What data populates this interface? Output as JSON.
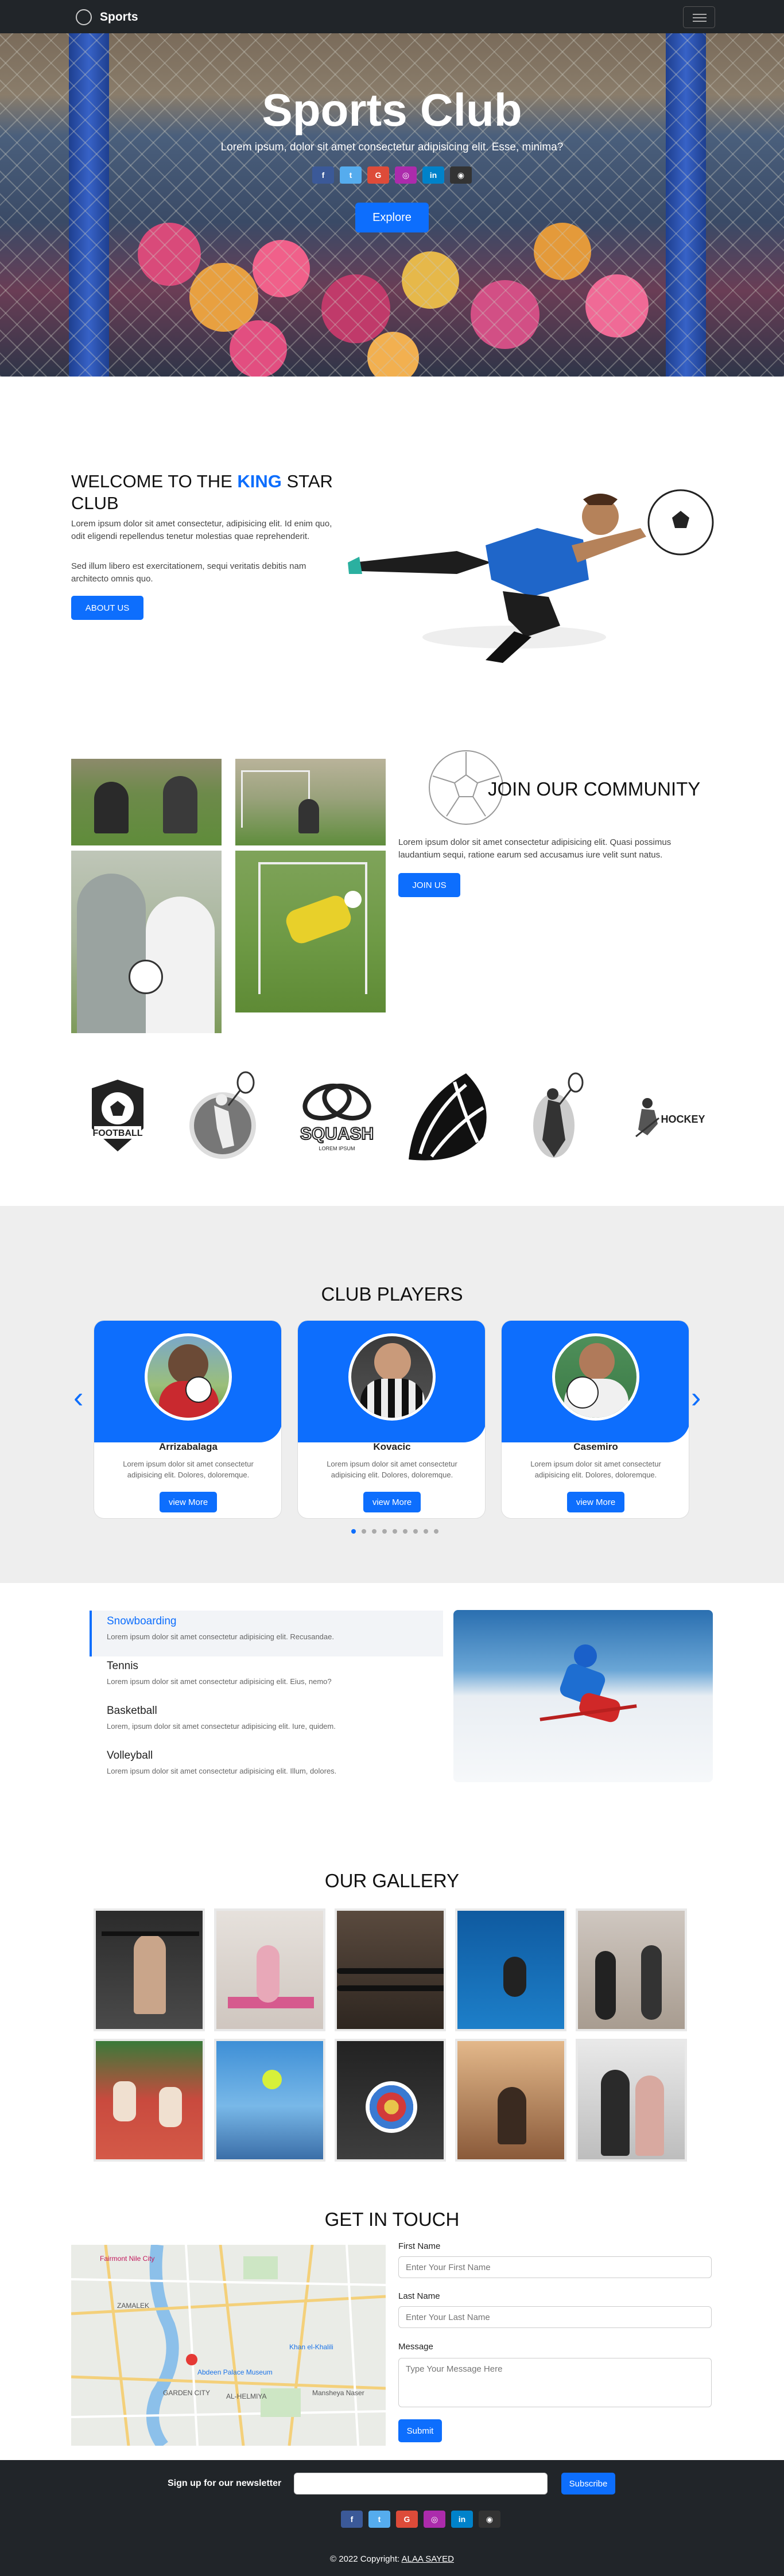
{
  "nav": {
    "brand": "Sports"
  },
  "hero": {
    "title": "Sports Club",
    "subtitle": "Lorem ipsum, dolor sit amet consectetur adipisicing elit. Esse, minima?",
    "explore": "Explore",
    "social": [
      {
        "icon": "facebook-icon",
        "glyph": "f",
        "color": "#3b5998"
      },
      {
        "icon": "twitter-icon",
        "glyph": "t",
        "color": "#55acee"
      },
      {
        "icon": "google-icon",
        "glyph": "G",
        "color": "#dd4b39"
      },
      {
        "icon": "instagram-icon",
        "glyph": "◎",
        "color": "#ac2bac"
      },
      {
        "icon": "linkedin-icon",
        "glyph": "in",
        "color": "#0082ca"
      },
      {
        "icon": "github-icon",
        "glyph": "◉",
        "color": "#333333"
      }
    ]
  },
  "welcome": {
    "title_pre": "WELCOME TO THE ",
    "title_king": "KING",
    "title_post": " STAR CLUB",
    "p1": "Lorem ipsum dolor sit amet consectetur, adipisicing elit. Id enim quo, odit eligendi repellendus tenetur molestias quae reprehenderit.",
    "p2": "Sed illum libero est exercitationem, sequi veritatis debitis nam architecto omnis quo.",
    "button": "ABOUT US"
  },
  "community": {
    "title": "JOIN OUR COMMUNITY",
    "text": "Lorem ipsum dolor sit amet consectetur adipisicing elit. Quasi possimus laudantium sequi, ratione earum sed accusamus iure velit sunt natus.",
    "button": "JOIN US"
  },
  "logos": {
    "football": "FOOTBALL",
    "squash": "SQUASH",
    "squash_sub": "LOREM IPSUM",
    "hockey": "HOCKEY"
  },
  "players": {
    "title": "CLUB PLAYERS",
    "cards": [
      {
        "name": "Arrizabalaga",
        "desc": "Lorem ipsum dolor sit amet consectetur adipisicing elit. Dolores, doloremque.",
        "button": "view More"
      },
      {
        "name": "Kovacic",
        "desc": "Lorem ipsum dolor sit amet consectetur adipisicing elit. Dolores, doloremque.",
        "button": "view More"
      },
      {
        "name": "Casemiro",
        "desc": "Lorem ipsum dolor sit amet consectetur adipisicing elit. Dolores, doloremque.",
        "button": "view More"
      }
    ],
    "dot_count": 9,
    "active_dot": 0
  },
  "sports": [
    {
      "title": "Snowboarding",
      "desc": "Lorem ipsum dolor sit amet consectetur adipisicing elit. Recusandae.",
      "active": true
    },
    {
      "title": "Tennis",
      "desc": "Lorem ipsum dolor sit amet consectetur adipisicing elit. Eius, nemo?",
      "active": false
    },
    {
      "title": "Basketball",
      "desc": "Lorem, ipsum dolor sit amet consectetur adipisicing elit. Iure, quidem.",
      "active": false
    },
    {
      "title": "Volleyball",
      "desc": "Lorem ipsum dolor sit amet consectetur adipisicing elit. Illum, dolores.",
      "active": false
    }
  ],
  "gallery": {
    "title": "OUR GALLERY"
  },
  "contact": {
    "title": "GET IN TOUCH",
    "first_label": "First Name",
    "first_placeholder": "Enter Your First Name",
    "last_label": "Last Name",
    "last_placeholder": "Enter Your Last Name",
    "message_label": "Message",
    "message_placeholder": "Type Your Message Here",
    "submit": "Submit",
    "map_labels": {
      "zamalek": "ZAMALEK",
      "garden_city": "GARDEN CITY",
      "helmiya": "AL-HELMIYA",
      "mansheya": "Mansheya Naser",
      "abdeen": "Abdeen Palace Museum",
      "khan": "Khan el-Khalili",
      "fairmont": "Fairmont Nile City"
    }
  },
  "footer": {
    "newsletter": "Sign up for our newsletter",
    "subscribe": "Subscribe",
    "copyright_pre": "© 2022 Copyright: ",
    "copyright_link": "ALAA SAYED"
  }
}
